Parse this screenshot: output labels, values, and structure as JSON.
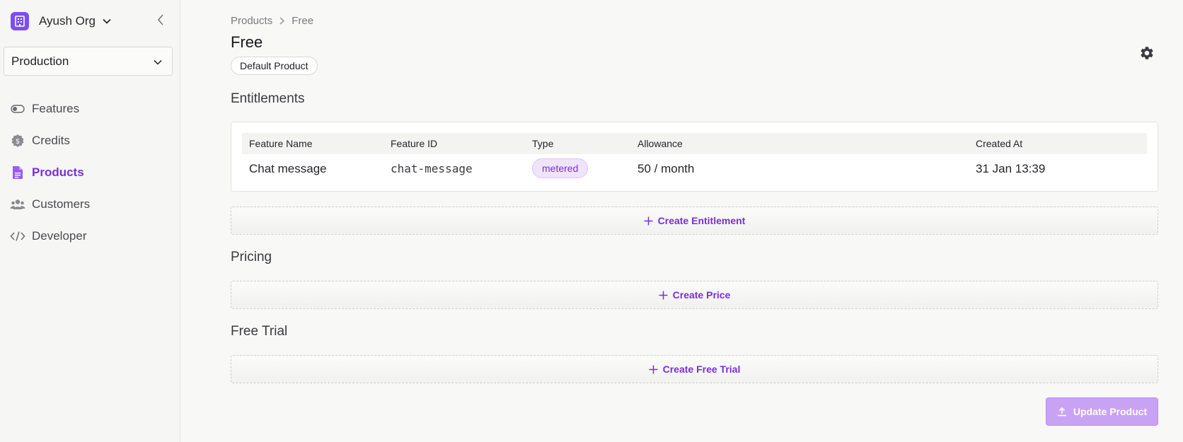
{
  "sidebar": {
    "org_name": "Ayush Org",
    "environment": "Production",
    "items": [
      {
        "label": "Features",
        "icon": "toggle-icon",
        "active": false
      },
      {
        "label": "Credits",
        "icon": "coin-icon",
        "active": false
      },
      {
        "label": "Products",
        "icon": "document-icon",
        "active": true
      },
      {
        "label": "Customers",
        "icon": "users-icon",
        "active": false
      },
      {
        "label": "Developer",
        "icon": "code-icon",
        "active": false
      }
    ]
  },
  "breadcrumb": {
    "parent": "Products",
    "current": "Free"
  },
  "page": {
    "title": "Free",
    "badge": "Default Product"
  },
  "entitlements": {
    "title": "Entitlements",
    "columns": [
      "Feature Name",
      "Feature ID",
      "Type",
      "Allowance",
      "Created At"
    ],
    "rows": [
      {
        "feature_name": "Chat message",
        "feature_id": "chat-message",
        "type": "metered",
        "allowance": "50 / month",
        "created_at": "31 Jan 13:39"
      }
    ],
    "create_label": "Create Entitlement"
  },
  "pricing": {
    "title": "Pricing",
    "create_label": "Create Price"
  },
  "free_trial": {
    "title": "Free Trial",
    "create_label": "Create Free Trial"
  },
  "actions": {
    "update_label": "Update Product"
  },
  "colors": {
    "accent": "#7a2fd8",
    "org_logo": "#7c4df0",
    "update_button": "#c9a3f3"
  }
}
